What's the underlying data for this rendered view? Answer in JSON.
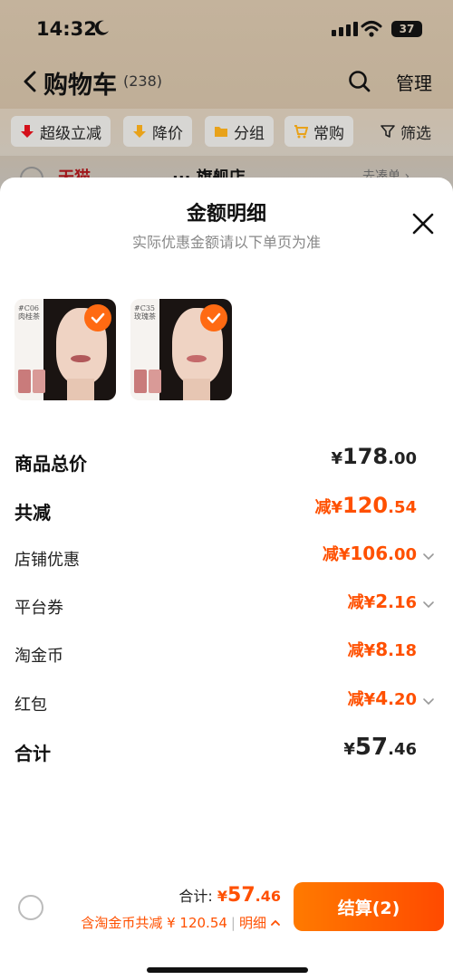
{
  "status": {
    "time": "14:32",
    "battery": "37"
  },
  "nav": {
    "title": "购物车",
    "count": "(238)",
    "manage": "管理"
  },
  "filters": {
    "items": [
      "超级立减",
      "降价",
      "分组",
      "常购"
    ],
    "filter_label": "筛选"
  },
  "peek": {
    "t1": "天猫",
    "t2": "··· 旗舰店",
    "t3": "去凑单 ›"
  },
  "sheet": {
    "title": "金额明细",
    "subtitle": "实际优惠金额请以下单页为准",
    "products": [
      {
        "code": "#C06\n肉桂茶"
      },
      {
        "code": "#C35\n玫瑰茶"
      }
    ],
    "rows": {
      "total_price": {
        "label": "商品总价",
        "prefix": "¥",
        "int": "178",
        "dec": ".00"
      },
      "total_discount": {
        "label": "共减",
        "prefix": "减¥",
        "int": "120",
        "dec": ".54"
      },
      "store_discount": {
        "label": "店铺优惠",
        "prefix": "减¥",
        "int": "106",
        "dec": ".00"
      },
      "platform_coupon": {
        "label": "平台券",
        "prefix": "减¥",
        "int": "2",
        "dec": ".16"
      },
      "taobao_coins": {
        "label": "淘金币",
        "prefix": "减¥",
        "int": "8",
        "dec": ".18"
      },
      "red_packet": {
        "label": "红包",
        "prefix": "减¥",
        "int": "4",
        "dec": ".20"
      },
      "sum": {
        "label": "合计",
        "prefix": "¥",
        "int": "57",
        "dec": ".46"
      }
    }
  },
  "footer": {
    "total_label": "合计:",
    "total_prefix": "¥",
    "total_int": "57",
    "total_dec": ".46",
    "discount_text": "含淘金币共减 ¥ 120.54",
    "detail_label": "明细",
    "checkout_label": "结算(2)"
  },
  "colors": {
    "accent": "#ff5000",
    "check": "#ff6a12"
  }
}
